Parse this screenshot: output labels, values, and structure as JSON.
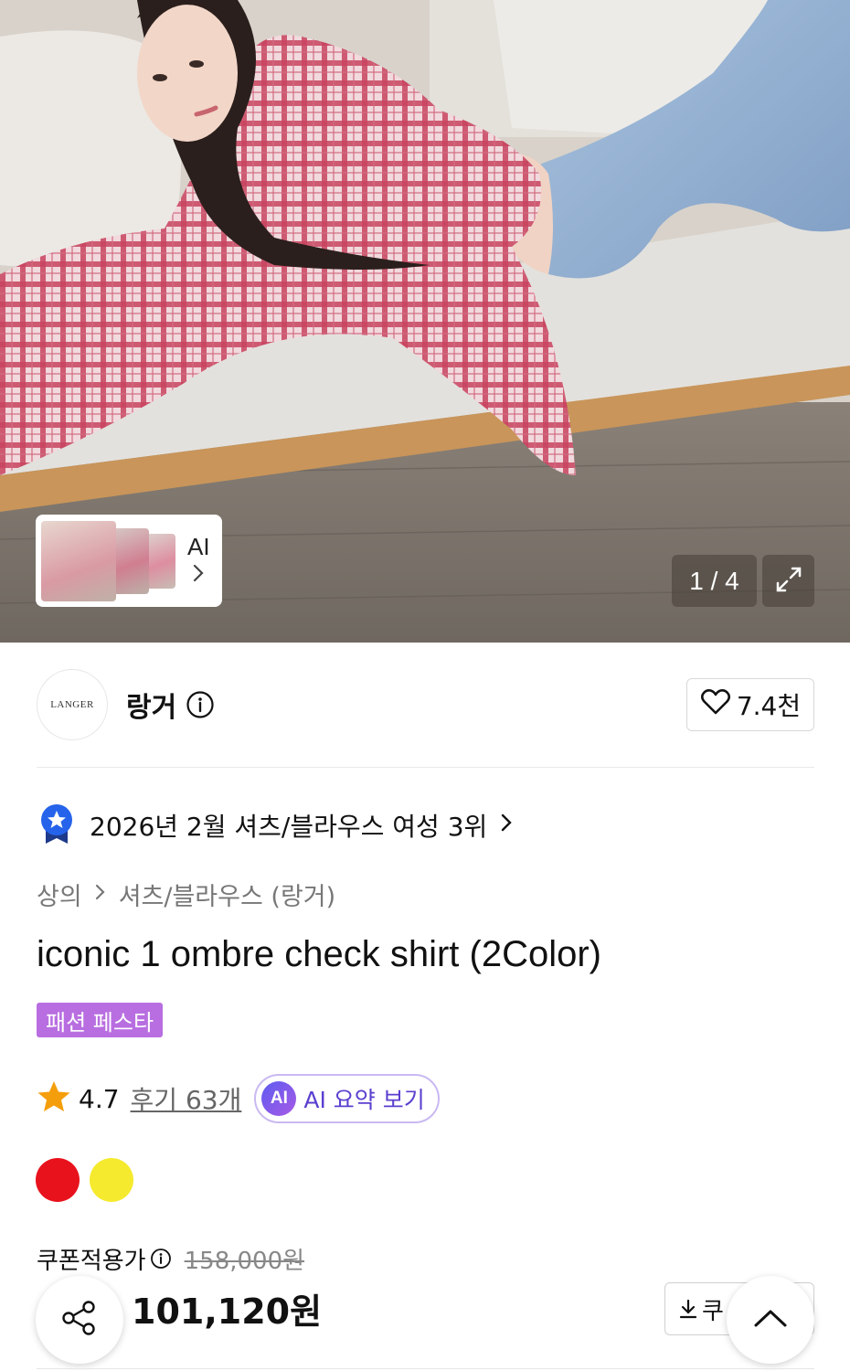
{
  "gallery": {
    "counter": "1 / 4",
    "ai_label": "AI"
  },
  "shop": {
    "logo_text": "LANGER",
    "name": "랑거",
    "like_count": "7.4천"
  },
  "ranking": {
    "text": "2026년 2월 셔츠/블라우스 여성 3위"
  },
  "breadcrumb": {
    "category": "상의",
    "subcategory": "셔츠/블라우스 (랑거)"
  },
  "product": {
    "title": "iconic 1 ombre check shirt (2Color)",
    "badge": "패션 페스타"
  },
  "rating": {
    "score": "4.7",
    "reviews": "후기 63개",
    "ai_summary": "AI 요약 보기",
    "ai_badge": "AI"
  },
  "colors": {
    "swatches": [
      "#e8121c",
      "#f5ea2d"
    ]
  },
  "price": {
    "coupon_label": "쿠폰적용가",
    "original": "158,000원",
    "discount": "",
    "final": "101,120원",
    "coupon_button": "쿠"
  },
  "icons": {
    "thumb_chevron": "chevron-right-icon",
    "expand": "expand-icon",
    "info": "info-icon",
    "heart": "heart-icon",
    "rank": "ribbon-star-icon",
    "star": "star-icon",
    "share": "share-icon",
    "scroll_top": "chevron-up-icon",
    "download": "download-icon"
  },
  "accent_colors": {
    "discount_red": "#e8121c",
    "festa_purple": "#b86ee0",
    "ai_purple": "#5b3fcf",
    "rank_blue": "#2563eb",
    "star_orange": "#f59e0b"
  }
}
